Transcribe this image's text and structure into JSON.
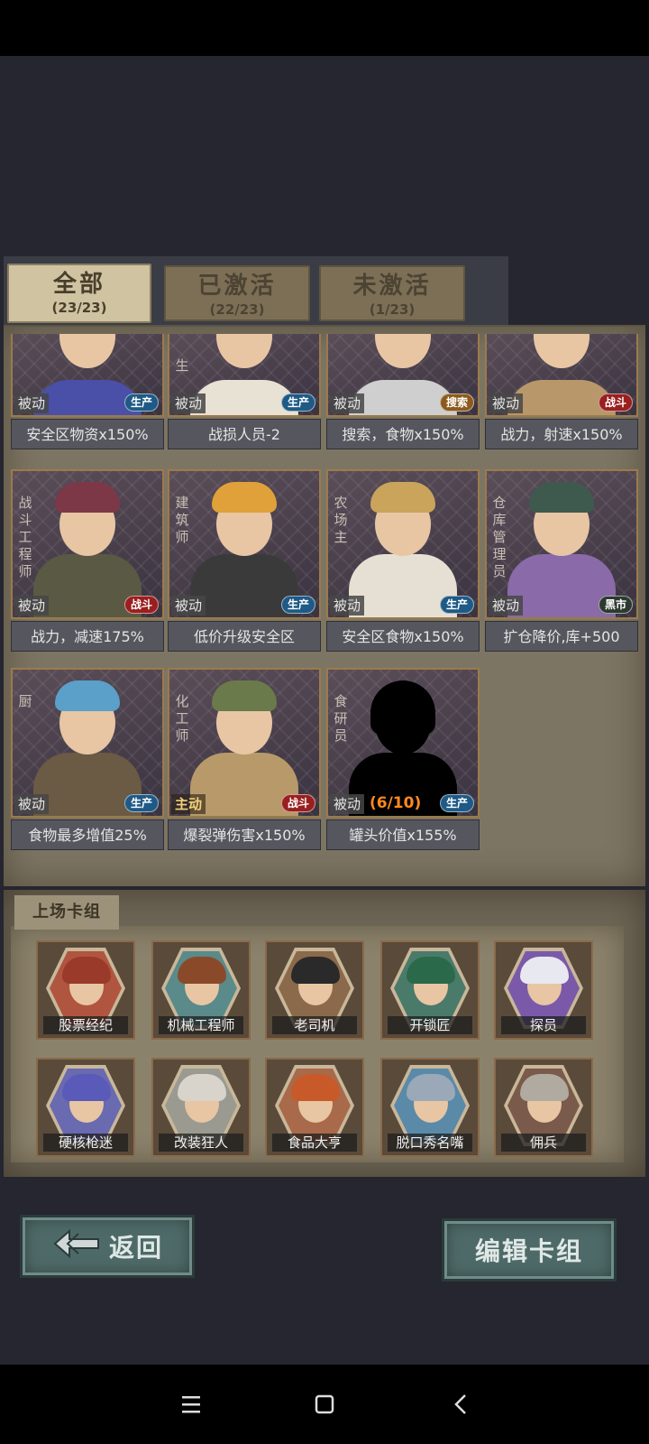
{
  "tabs": [
    {
      "label": "全部",
      "count": "(23/23)"
    },
    {
      "label": "已激活",
      "count": "(22/23)"
    },
    {
      "label": "未激活",
      "count": "(1/23)"
    }
  ],
  "cards": [
    {
      "role": "",
      "kind": "被动",
      "badge": "生产",
      "badge_type": "prod",
      "desc": "安全区物资x150%",
      "hair": "#7a4fb5",
      "shirt": "#4a4fa8"
    },
    {
      "role": "生",
      "kind": "被动",
      "badge": "生产",
      "badge_type": "prod",
      "desc": "战损人员-2",
      "hair": "#d9a441",
      "shirt": "#e8e2d5"
    },
    {
      "role": "",
      "kind": "被动",
      "badge": "搜索",
      "badge_type": "search",
      "desc": "搜索，食物x150%",
      "hair": "#5a3a2a",
      "shirt": "#cfcfcf"
    },
    {
      "role": "",
      "kind": "被动",
      "badge": "战斗",
      "badge_type": "fight",
      "desc": "战力，射速x150%",
      "hair": "#6b4a33",
      "shirt": "#b8976a"
    },
    {
      "role": "战斗工程师",
      "kind": "被动",
      "badge": "战斗",
      "badge_type": "fight",
      "desc": "战力，减速175%",
      "hair": "#7d3848",
      "shirt": "#5a5a44"
    },
    {
      "role": "建筑师",
      "kind": "被动",
      "badge": "生产",
      "badge_type": "prod",
      "desc": "低价升级安全区",
      "hair": "#e0a13a",
      "shirt": "#3a3a3a"
    },
    {
      "role": "农场主",
      "kind": "被动",
      "badge": "生产",
      "badge_type": "prod",
      "desc": "安全区食物x150%",
      "hair": "#c9a45a",
      "shirt": "#e6e0d4"
    },
    {
      "role": "仓库管理员",
      "kind": "被动",
      "badge": "黑市",
      "badge_type": "black",
      "desc": "扩仓降价,库+500",
      "hair": "#3e5a4e",
      "shirt": "#8a6aa8"
    },
    {
      "role": "厨",
      "kind": "被动",
      "badge": "生产",
      "badge_type": "prod",
      "desc": "食物最多增值25%",
      "hair": "#5aa0c8",
      "shirt": "#6b5a44"
    },
    {
      "role": "化工师",
      "kind": "主动",
      "badge": "战斗",
      "badge_type": "fight",
      "desc": "爆裂弹伤害x150%",
      "hair": "#6a7a4a",
      "shirt": "#b89a6a"
    },
    {
      "role": "食研员",
      "kind": "被动",
      "badge": "生产",
      "badge_type": "prod",
      "desc": "罐头价值x155%",
      "progress": "(6/10)",
      "hair": "#000000",
      "shirt": "#000000"
    }
  ],
  "deck": {
    "title": "上场卡组",
    "members": [
      {
        "name": "股票经纪",
        "hair": "#9a3a2a",
        "bg": "#b0553f"
      },
      {
        "name": "机械工程师",
        "hair": "#8a4a2a",
        "bg": "#5a8a8a"
      },
      {
        "name": "老司机",
        "hair": "#2a2a2a",
        "bg": "#8a6a4a"
      },
      {
        "name": "开锁匠",
        "hair": "#2a6a4a",
        "bg": "#4a7a6a"
      },
      {
        "name": "探员",
        "hair": "#e8e8f0",
        "bg": "#7a5aa8"
      },
      {
        "name": "硬核枪迷",
        "hair": "#5a5ab8",
        "bg": "#6a6ab0"
      },
      {
        "name": "改装狂人",
        "hair": "#d8d4cc",
        "bg": "#9a9a90"
      },
      {
        "name": "食品大亨",
        "hair": "#c85a2a",
        "bg": "#a86a4a"
      },
      {
        "name": "脱口秀名嘴",
        "hair": "#9aa8b8",
        "bg": "#5a8aa8"
      },
      {
        "name": "佣兵",
        "hair": "#b0aaa0",
        "bg": "#7a5a4a"
      }
    ]
  },
  "buttons": {
    "back": "返回",
    "edit": "编辑卡组"
  }
}
